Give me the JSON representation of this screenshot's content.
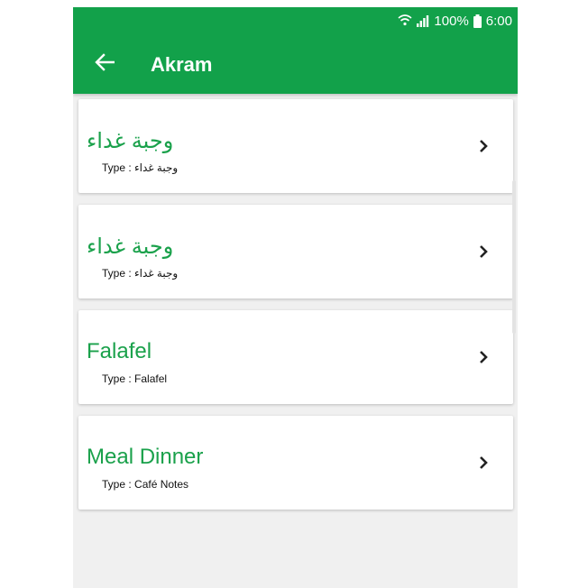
{
  "status": {
    "battery": "100%",
    "time": "6:00"
  },
  "toolbar": {
    "title": "Akram"
  },
  "items": [
    {
      "title": "وجبة غداء",
      "type_prefix": "Type : ",
      "type_value": "وجبة غداء"
    },
    {
      "title": "وجبة غداء",
      "type_prefix": "Type : ",
      "type_value": "وجبة غداء"
    },
    {
      "title": "Falafel",
      "type_prefix": "Type : ",
      "type_value": "Falafel"
    },
    {
      "title": "Meal  Dinner",
      "type_prefix": "Type : ",
      "type_value": "Café Notes"
    }
  ],
  "colors": {
    "primary": "#12a14a",
    "accent_text": "#1aa14b",
    "background": "#f0f0f0"
  }
}
